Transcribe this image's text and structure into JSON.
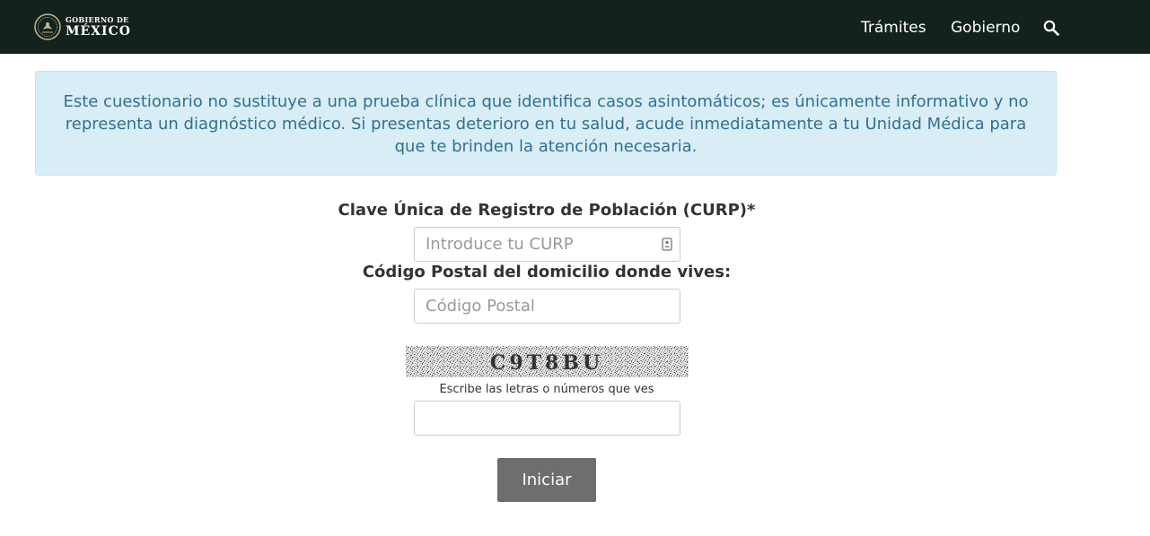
{
  "navbar": {
    "logo_line1": "GOBIERNO DE",
    "logo_line2": "MÉXICO",
    "links": [
      {
        "label": "Trámites"
      },
      {
        "label": "Gobierno"
      }
    ],
    "search_icon": "search-icon",
    "background": "#13221d"
  },
  "alert": {
    "text": "Este cuestionario no sustituye a una prueba clínica que identifica casos asintomáticos; es únicamente informativo y no representa un diagnóstico médico. Si presentas deterioro en tu salud, acude inmediatamente a tu Unidad Médica para que te brinden la atención necesaria.",
    "background": "#d9edf7",
    "text_color": "#31708f"
  },
  "form": {
    "curp": {
      "label": "Clave Única de Registro de Población (CURP)*",
      "placeholder": "Introduce tu CURP",
      "value": ""
    },
    "postal_code": {
      "label": "Código Postal del domicilio donde vives:",
      "placeholder": "Código Postal",
      "value": ""
    },
    "captcha": {
      "code": "C9T8BU",
      "hint": "Escribe las letras o números que ves",
      "value": ""
    },
    "submit_label": "Iniciar",
    "submit_color": "#6e6e6e"
  }
}
